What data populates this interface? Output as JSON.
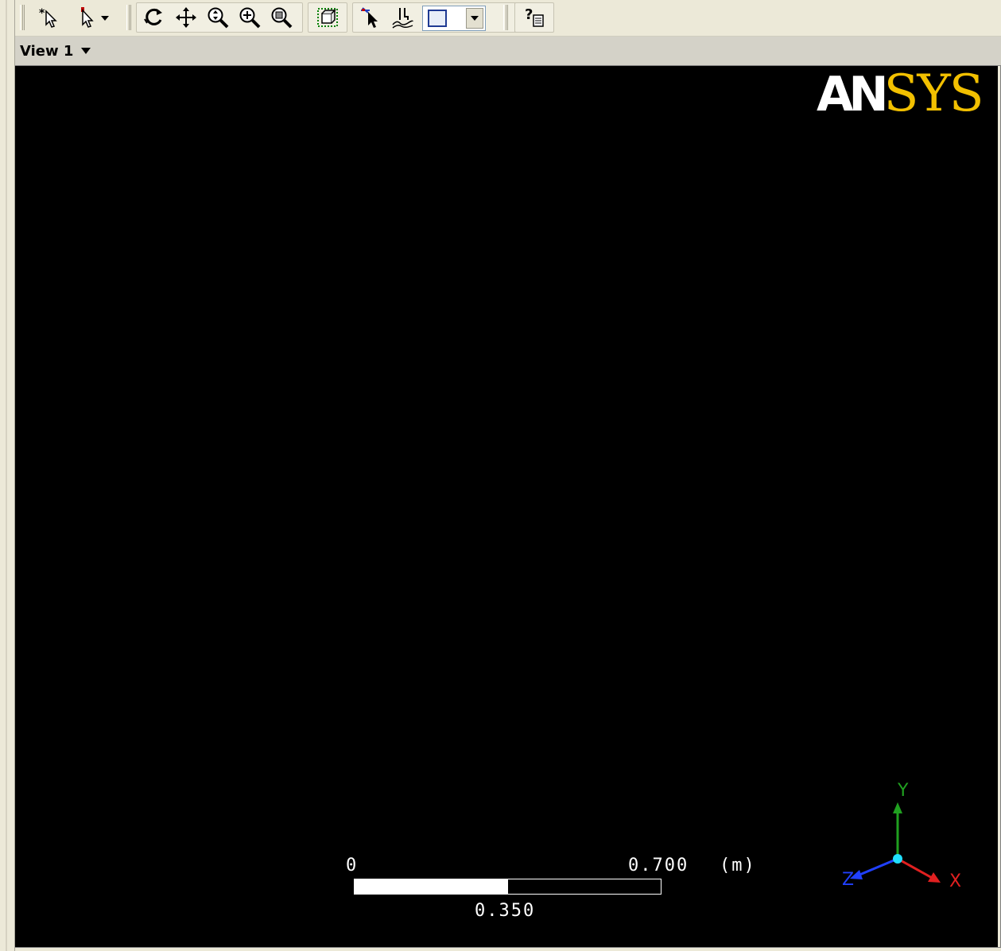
{
  "toolbar": {
    "buttons": [
      {
        "icon": "select-new-icon",
        "label": "Select"
      },
      {
        "icon": "select-mode-icon",
        "label": "Selection Mode"
      },
      {
        "icon": "rotate-icon",
        "label": "Rotate"
      },
      {
        "icon": "pan-icon",
        "label": "Pan"
      },
      {
        "icon": "zoom-icon",
        "label": "Zoom"
      },
      {
        "icon": "zoom-box-icon",
        "label": "Zoom Box"
      },
      {
        "icon": "zoom-fit-icon",
        "label": "Fit View"
      },
      {
        "icon": "fit-to-window-icon",
        "label": "Fit to Window"
      },
      {
        "icon": "probe-icon",
        "label": "Probe"
      },
      {
        "icon": "snap-icon",
        "label": "Snap"
      },
      {
        "icon": "help-icon",
        "label": "Help"
      }
    ],
    "viewport_layout_selected": "single"
  },
  "view": {
    "title": "View 1"
  },
  "logo": {
    "part1": "AN",
    "part2": "SYS"
  },
  "scale": {
    "min_label": "0",
    "mid_label": "0.350",
    "max_label": "0.700",
    "unit": "(m)",
    "fill_fraction": 0.5
  },
  "triad": {
    "x": "X",
    "y": "Y",
    "z": "Z",
    "colors": {
      "x": "#e02020",
      "y": "#20a020",
      "z": "#2040ff",
      "origin": "#20e0ff"
    }
  },
  "colors": {
    "viewport_bg": "#000000",
    "logo_accent": "#f2c000"
  }
}
